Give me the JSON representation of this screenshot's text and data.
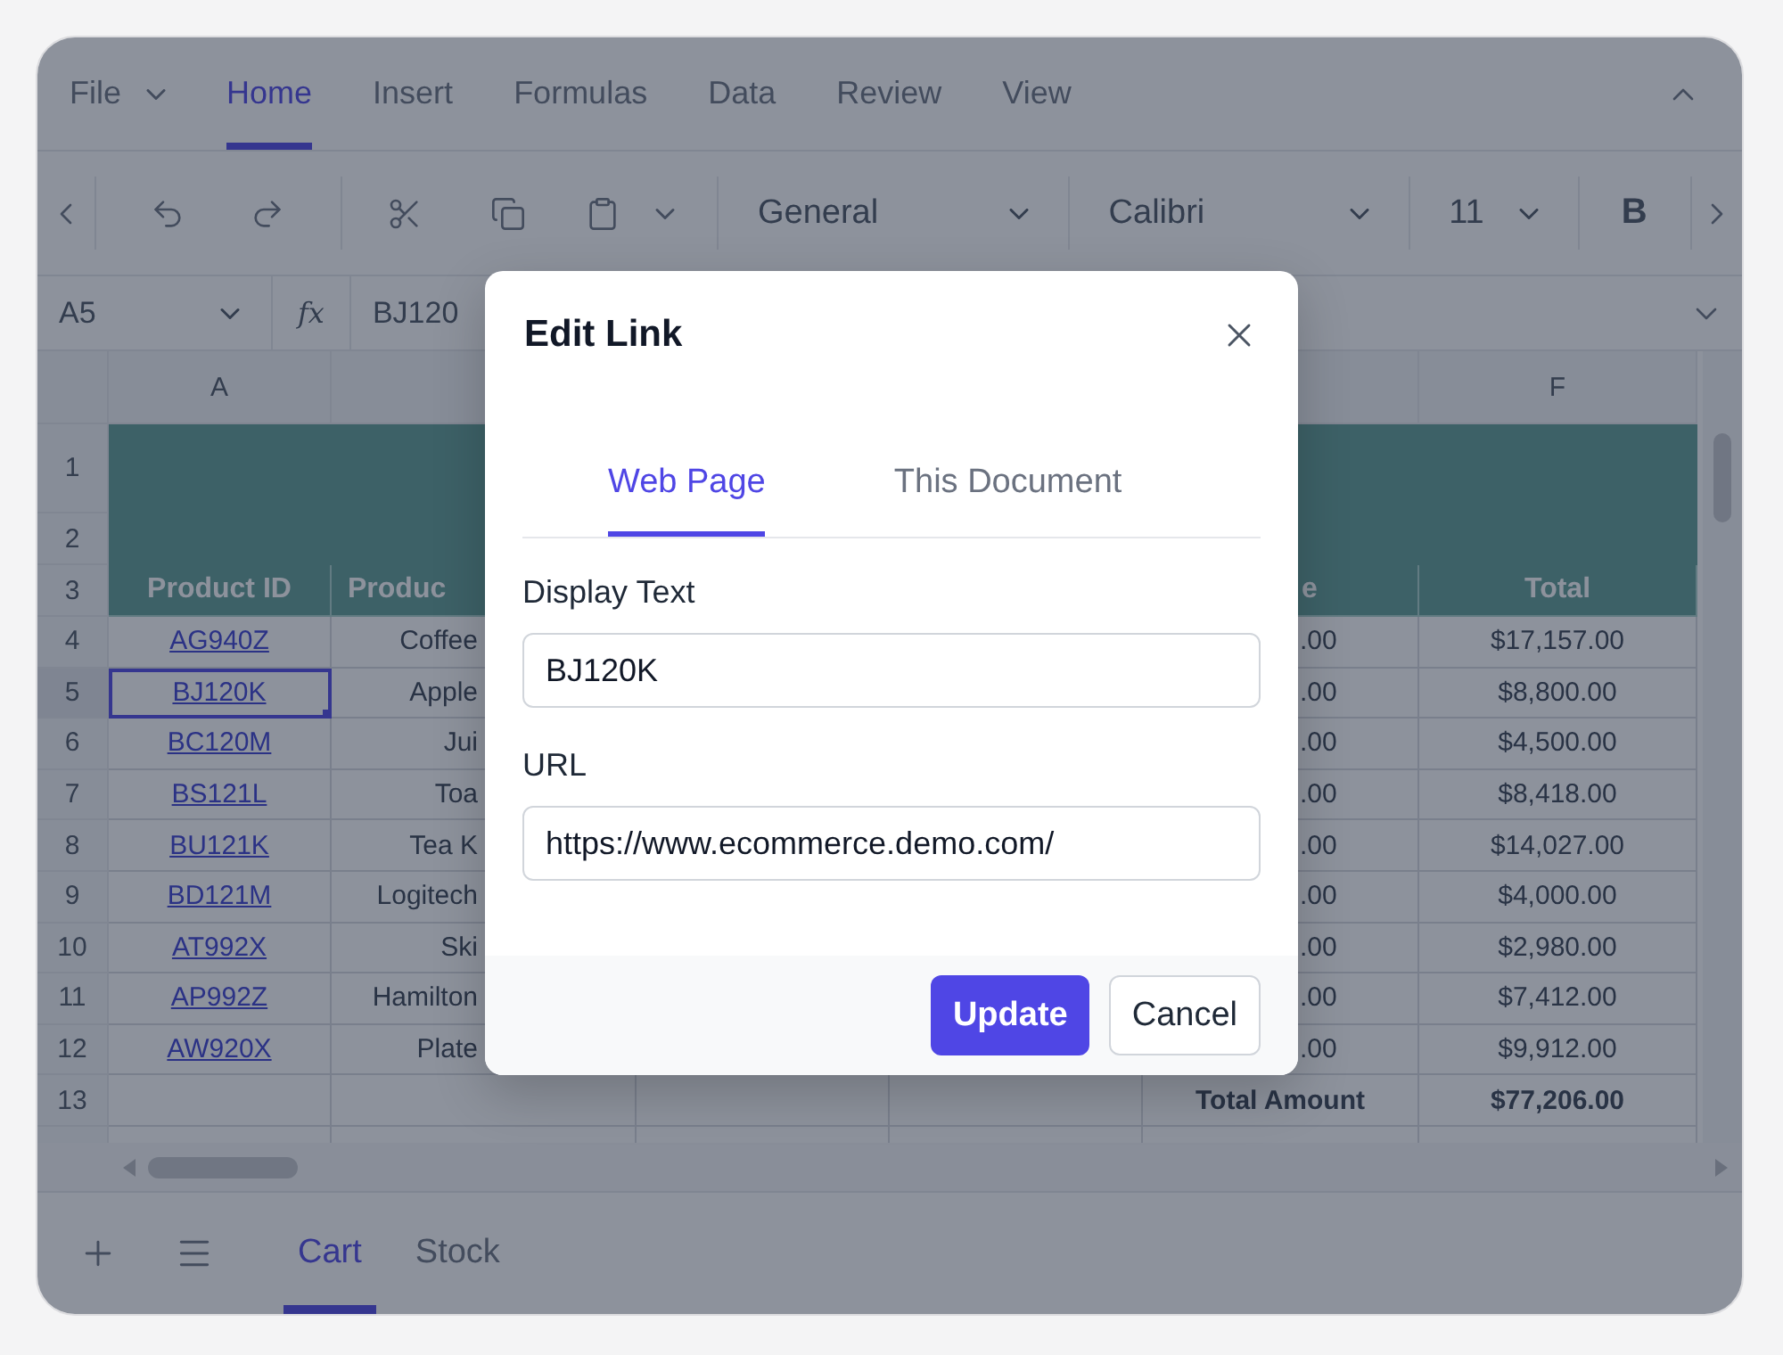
{
  "ribbon_tabs": [
    {
      "label": "File",
      "kind": "menu",
      "selected": false
    },
    {
      "label": "Home",
      "kind": "tab",
      "selected": true
    },
    {
      "label": "Insert",
      "kind": "tab",
      "selected": false
    },
    {
      "label": "Formulas",
      "kind": "tab",
      "selected": false
    },
    {
      "label": "Data",
      "kind": "tab",
      "selected": false
    },
    {
      "label": "Review",
      "kind": "tab",
      "selected": false
    },
    {
      "label": "View",
      "kind": "tab",
      "selected": false
    }
  ],
  "toolbar": {
    "number_format": "General",
    "font": "Calibri",
    "font_size": "11",
    "bold": "B"
  },
  "formula_bar": {
    "name_box": "A5",
    "function_label": "fx",
    "formula": "BJ120"
  },
  "columns": [
    {
      "label": "A"
    },
    {
      "label": "F"
    }
  ],
  "rows": [
    {
      "number": "1",
      "kind": "title"
    },
    {
      "number": "2",
      "kind": "title"
    },
    {
      "number": "3",
      "kind": "header",
      "cells": [
        "Product ID",
        "Produc",
        "e",
        "Total"
      ]
    },
    {
      "number": "4",
      "kind": "item",
      "selected": false,
      "cells": [
        "AG940Z",
        "Coffee",
        ".00",
        "$17,157.00"
      ]
    },
    {
      "number": "5",
      "kind": "item",
      "selected": true,
      "cells": [
        "BJ120K",
        "Apple",
        ".00",
        "$8,800.00"
      ]
    },
    {
      "number": "6",
      "kind": "item",
      "selected": false,
      "cells": [
        "BC120M",
        "Jui",
        ".00",
        "$4,500.00"
      ]
    },
    {
      "number": "7",
      "kind": "item",
      "selected": false,
      "cells": [
        "BS121L",
        "Toa",
        ".00",
        "$8,418.00"
      ]
    },
    {
      "number": "8",
      "kind": "item",
      "selected": false,
      "cells": [
        "BU121K",
        "Tea K",
        ".00",
        "$14,027.00"
      ]
    },
    {
      "number": "9",
      "kind": "item",
      "selected": false,
      "cells": [
        "BD121M",
        "Logitech",
        ".00",
        "$4,000.00"
      ]
    },
    {
      "number": "10",
      "kind": "item",
      "selected": false,
      "cells": [
        "AT992X",
        "Ski",
        ".00",
        "$2,980.00"
      ]
    },
    {
      "number": "11",
      "kind": "item",
      "selected": false,
      "cells": [
        "AP992Z",
        "Hamilton",
        ".00",
        "$7,412.00"
      ]
    },
    {
      "number": "12",
      "kind": "item",
      "selected": false,
      "cells": [
        "AW920X",
        "Plate",
        ".00",
        "$9,912.00"
      ]
    },
    {
      "number": "13",
      "kind": "total",
      "cells": [
        "Total Amount",
        "$77,206.00"
      ]
    }
  ],
  "sheet_tabs": [
    {
      "label": "Cart",
      "selected": true
    },
    {
      "label": "Stock",
      "selected": false
    }
  ],
  "dialog": {
    "title": "Edit Link",
    "tabs": [
      {
        "label": "Web Page",
        "selected": true
      },
      {
        "label": "This Document",
        "selected": false
      }
    ],
    "fields": [
      {
        "label": "Display Text",
        "value": "BJ120K"
      },
      {
        "label": "URL",
        "value": "https://www.ecommerce.demo.com/"
      }
    ],
    "buttons": [
      {
        "label": "Update",
        "kind": "primary"
      },
      {
        "label": "Cancel",
        "kind": "secondary"
      }
    ]
  }
}
